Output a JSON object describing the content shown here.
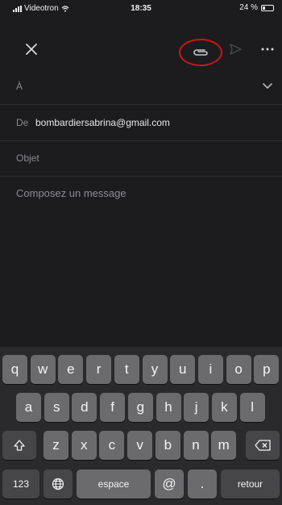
{
  "status_bar": {
    "carrier": "Videotron",
    "time": "18:35",
    "battery_label": "24 %",
    "battery_level": 0.24
  },
  "toolbar": {
    "close_icon": "close-icon",
    "attach_icon": "paperclip-icon",
    "send_icon": "send-icon",
    "more_icon": "more-icon",
    "highlight_color": "#d11414"
  },
  "compose": {
    "to_label": "À",
    "from_label": "De",
    "from_value": "bombardiersabrina@gmail.com",
    "subject_placeholder": "Objet",
    "body_placeholder": "Composez un message"
  },
  "keyboard": {
    "row1": [
      "q",
      "w",
      "e",
      "r",
      "t",
      "y",
      "u",
      "i",
      "o",
      "p"
    ],
    "row2": [
      "a",
      "s",
      "d",
      "f",
      "g",
      "h",
      "j",
      "k",
      "l"
    ],
    "row3": [
      "z",
      "x",
      "c",
      "v",
      "b",
      "n",
      "m"
    ],
    "numbers_key": "123",
    "space_key": "espace",
    "at_key": "@",
    "dot_key": ".",
    "return_key": "retour"
  }
}
